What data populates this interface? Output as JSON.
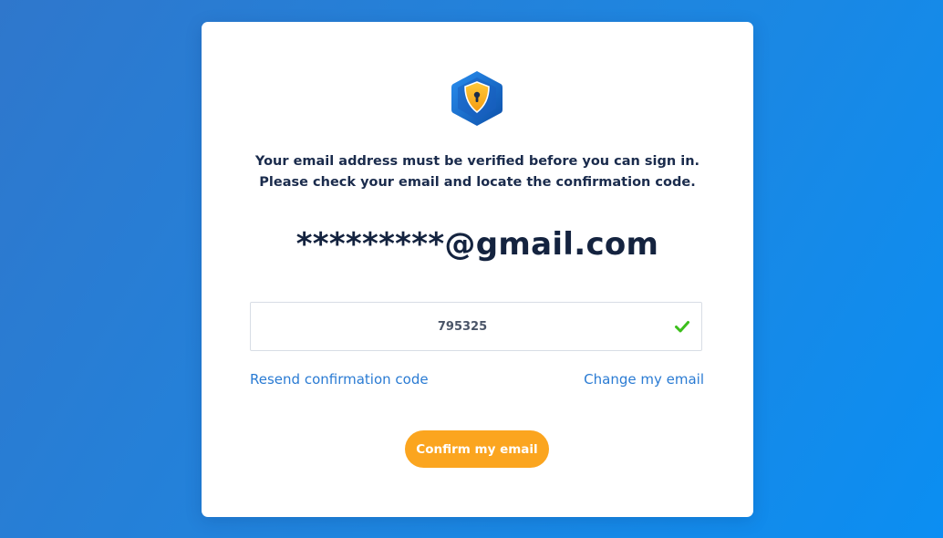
{
  "verification": {
    "message_line1": "Your email address must be verified before you can sign in.",
    "message_line2": "Please check your email and locate the confirmation code.",
    "masked_email": "*********@gmail.com",
    "code_value": "795325",
    "logo_icon": "shield-lock-icon",
    "status_icon": "check-icon",
    "resend_label": "Resend confirmation code",
    "change_label": "Change my email",
    "confirm_label": "Confirm my email"
  },
  "colors": {
    "background": "#1e86e0",
    "text_dark": "#14233f",
    "link": "#2a7bd3",
    "button": "#fba51f",
    "check": "#3cbf1c"
  }
}
